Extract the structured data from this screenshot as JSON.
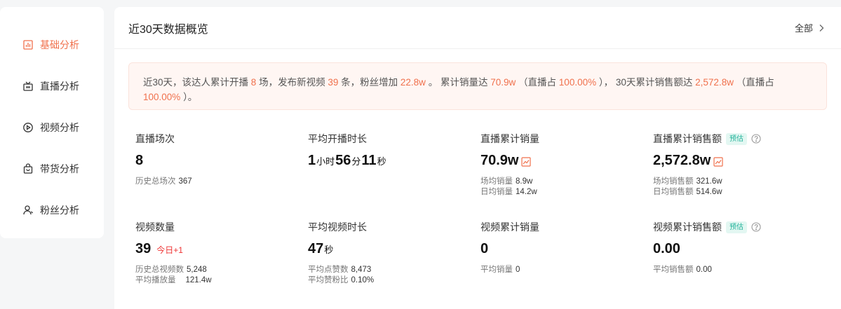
{
  "sidebar": {
    "items": [
      {
        "label": "基础分析",
        "icon": "bar-chart-icon",
        "active": true
      },
      {
        "label": "直播分析",
        "icon": "live-tv-icon",
        "active": false
      },
      {
        "label": "视频分析",
        "icon": "play-circle-icon",
        "active": false
      },
      {
        "label": "带货分析",
        "icon": "shopping-bag-icon",
        "active": false
      },
      {
        "label": "粉丝分析",
        "icon": "user-icon",
        "active": false
      }
    ]
  },
  "header": {
    "title": "近30天数据概览",
    "all_label": "全部"
  },
  "summary": {
    "p1": "近30天，该达人累计开播",
    "live_count": "8",
    "p2": "场，发布新视频",
    "video_count": "39",
    "p3": "条，粉丝增加",
    "fans_gain": "22.8w",
    "p4": "。 累计销量达",
    "sales": "70.9w",
    "p5": "（直播占",
    "sales_live_pct": "100.00%",
    "p6": "）， 30天累计销售额达",
    "gmv": "2,572.8w",
    "p7": "（直播占",
    "gmv_live_pct": "100.00%",
    "p8": "）。"
  },
  "stats": {
    "live_sessions": {
      "label": "直播场次",
      "value": "8",
      "sub1_label": "历史总场次",
      "sub1_value": "367"
    },
    "avg_live_duration": {
      "label": "平均开播时长",
      "h": "1",
      "h_unit": "小时",
      "m": "56",
      "m_unit": "分",
      "s": "11",
      "s_unit": "秒"
    },
    "live_sales": {
      "label": "直播累计销量",
      "value": "70.9w",
      "sub1_label": "场均销量",
      "sub1_value": "8.9w",
      "sub2_label": "日均销量",
      "sub2_value": "14.2w"
    },
    "live_gmv": {
      "label": "直播累计销售额",
      "badge": "预估",
      "value": "2,572.8w",
      "sub1_label": "场均销售额",
      "sub1_value": "321.6w",
      "sub2_label": "日均销售额",
      "sub2_value": "514.6w"
    },
    "video_count": {
      "label": "视频数量",
      "value": "39",
      "today": "今日+1",
      "sub1_label": "历史总视频数",
      "sub1_value": "5,248",
      "sub2_label": "平均播放量",
      "sub2_value": "121.4w"
    },
    "avg_video_duration": {
      "label": "平均视频时长",
      "value": "47",
      "unit": "秒",
      "sub1_label": "平均点赞数",
      "sub1_value": "8,473",
      "sub2_label": "平均赞粉比",
      "sub2_value": "0.10%"
    },
    "video_sales": {
      "label": "视频累计销量",
      "value": "0",
      "sub1_label": "平均销量",
      "sub1_value": "0"
    },
    "video_gmv": {
      "label": "视频累计销售额",
      "badge": "预估",
      "value": "0.00",
      "sub1_label": "平均销售额",
      "sub1_value": "0.00"
    }
  },
  "colors": {
    "accent": "#f0714d",
    "badge_text": "#23b39a",
    "today_red": "#e33333"
  }
}
